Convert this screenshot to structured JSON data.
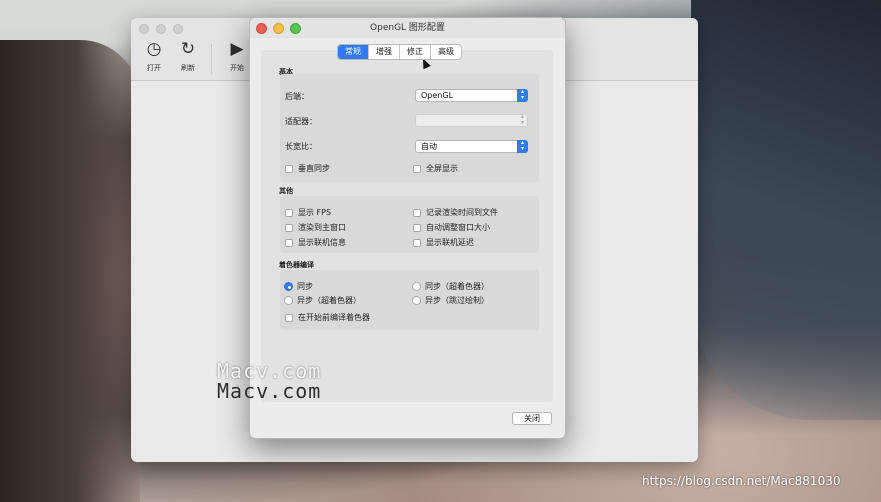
{
  "main_window": {
    "toolbar": [
      {
        "label": "打开",
        "icon": "open-icon"
      },
      {
        "label": "刷新",
        "icon": "refresh-icon"
      },
      {
        "label": "开始",
        "icon": "play-icon"
      }
    ]
  },
  "dialog": {
    "title": "OpenGL 图形配置",
    "tabs": [
      "常规",
      "增强",
      "修正",
      "高级"
    ],
    "active_tab": "常规",
    "basic": {
      "title": "基本",
      "backend_label": "后端：",
      "backend_value": "OpenGL",
      "adapter_label": "适配器：",
      "adapter_value": "",
      "aspect_label": "长宽比：",
      "aspect_value": "自动",
      "vsync_label": "垂直同步",
      "fullscreen_label": "全屏显示"
    },
    "other": {
      "title": "其他",
      "show_fps": "显示 FPS",
      "log_render_time": "记录渲染时间到文件",
      "render_to_main": "渲染到主窗口",
      "auto_resize": "自动调整窗口大小",
      "show_netplay_info": "显示联机信息",
      "show_netplay_ping": "显示联机延迟"
    },
    "shader": {
      "title": "着色器编译",
      "sync": "同步",
      "sync_uber": "同步（超着色器）",
      "async_uber": "异步（超着色器）",
      "async_skip": "异步（跳过绘制）",
      "precompile": "在开始前编译着色器"
    },
    "close_label": "关闭"
  },
  "watermark": "Macv.com",
  "credit": "https://blog.csdn.net/Mac881030",
  "colors": {
    "accent": "#2f7cf6",
    "close": "#ec5f56",
    "minimize": "#f5c043",
    "maximize": "#5ac453"
  }
}
